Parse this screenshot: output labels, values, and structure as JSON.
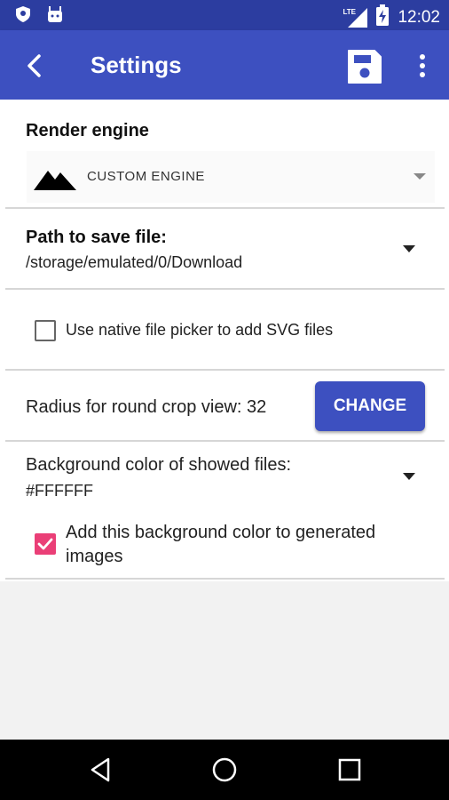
{
  "status_bar": {
    "network": "LTE",
    "time": "12:02"
  },
  "app_bar": {
    "title": "Settings"
  },
  "render_engine": {
    "label": "Render engine",
    "selected": "CUSTOM ENGINE"
  },
  "save_path": {
    "label": "Path to save file:",
    "value": "/storage/emulated/0/Download"
  },
  "native_picker": {
    "label": "Use native file picker to add SVG files",
    "checked": false
  },
  "radius": {
    "label": "Radius for round crop view: 32",
    "button": "CHANGE"
  },
  "background": {
    "label": "Background color of showed files:",
    "value": "#FFFFFF",
    "apply_label_line1": "Add this background color to generated",
    "apply_label_line2": "images",
    "apply_checked": true
  },
  "colors": {
    "primary": "#3d50c0",
    "primary_dark": "#2c3da0",
    "accent": "#ea3f77"
  }
}
